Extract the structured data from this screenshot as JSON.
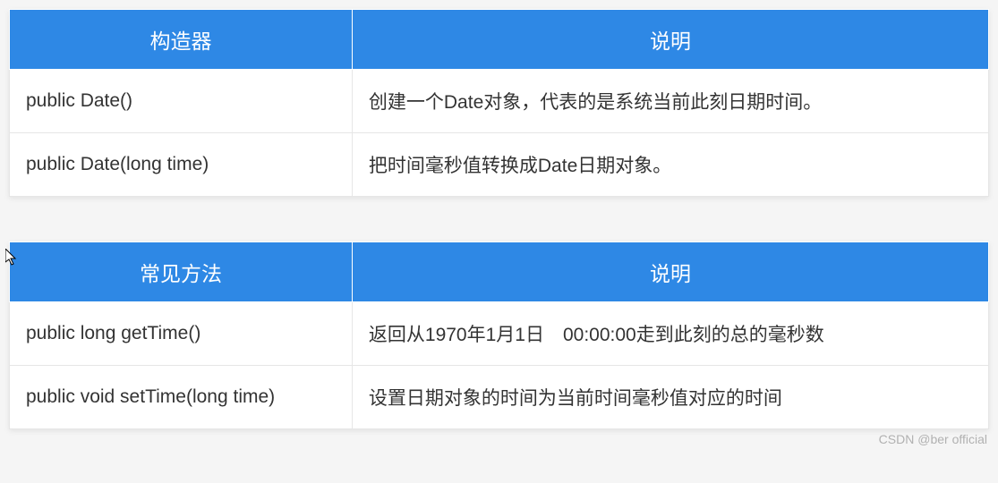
{
  "table1": {
    "header": {
      "left": "构造器",
      "right": "说明"
    },
    "rows": [
      {
        "left": "public Date()",
        "right": "创建一个Date对象，代表的是系统当前此刻日期时间。"
      },
      {
        "left": "public Date(long time)",
        "right": "把时间毫秒值转换成Date日期对象。"
      }
    ]
  },
  "table2": {
    "header": {
      "left": "常见方法",
      "right": "说明"
    },
    "rows": [
      {
        "left": "public long getTime()",
        "right": "返回从1970年1月1日　00:00:00走到此刻的总的毫秒数"
      },
      {
        "left": "public void setTime(long time)",
        "right": "设置日期对象的时间为当前时间毫秒值对应的时间"
      }
    ]
  },
  "watermark": "CSDN @ber official"
}
